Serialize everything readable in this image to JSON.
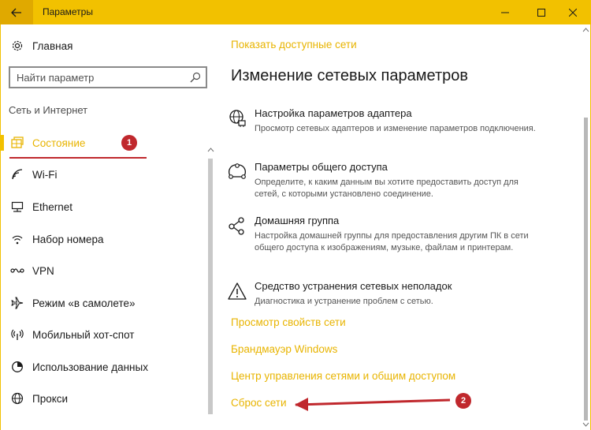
{
  "window": {
    "title": "Параметры",
    "accent_color": "#f2c100",
    "link_color": "#e8b400",
    "highlight_color": "#c0282d"
  },
  "icons": {
    "back": "arrow-left-icon",
    "minimize": "minimize-icon",
    "maximize": "maximize-icon",
    "close": "close-icon"
  },
  "sidebar": {
    "home_label": "Главная",
    "search": {
      "placeholder": "Найти параметр"
    },
    "section_title": "Сеть и Интернет",
    "items": [
      {
        "label": "Состояние",
        "icon": "globe-status-icon",
        "selected": true,
        "badge": "1"
      },
      {
        "label": "Wi-Fi",
        "icon": "wifi-icon"
      },
      {
        "label": "Ethernet",
        "icon": "ethernet-icon"
      },
      {
        "label": "Набор номера",
        "icon": "dialup-icon"
      },
      {
        "label": "VPN",
        "icon": "vpn-icon"
      },
      {
        "label": "Режим «в самолете»",
        "icon": "airplane-icon"
      },
      {
        "label": "Мобильный хот-спот",
        "icon": "hotspot-icon"
      },
      {
        "label": "Использование данных",
        "icon": "data-usage-icon"
      },
      {
        "label": "Прокси",
        "icon": "globe-icon"
      }
    ]
  },
  "content": {
    "show_networks_link": "Показать доступные сети",
    "heading": "Изменение сетевых параметров",
    "items": [
      {
        "title": "Настройка параметров адаптера",
        "desc": "Просмотр сетевых адаптеров и изменение параметров подключения.",
        "icon": "adapter-icon"
      },
      {
        "title": "Параметры общего доступа",
        "desc": "Определите, к каким данным вы хотите предоставить доступ для сетей, с которыми установлено соединение.",
        "icon": "sharing-icon"
      },
      {
        "title": "Домашняя группа",
        "desc": "Настройка домашней группы для предоставления другим ПК в сети общего доступа к изображениям, музыке, файлам и принтерам.",
        "icon": "homegroup-icon"
      },
      {
        "title": "Средство устранения сетевых неполадок",
        "desc": "Диагностика и устранение проблем с сетью.",
        "icon": "warning-icon"
      }
    ],
    "links": [
      "Просмотр свойств сети",
      "Брандмауэр Windows",
      "Центр управления сетями и общим доступом",
      "Сброс сети"
    ],
    "reset_badge": "2"
  }
}
